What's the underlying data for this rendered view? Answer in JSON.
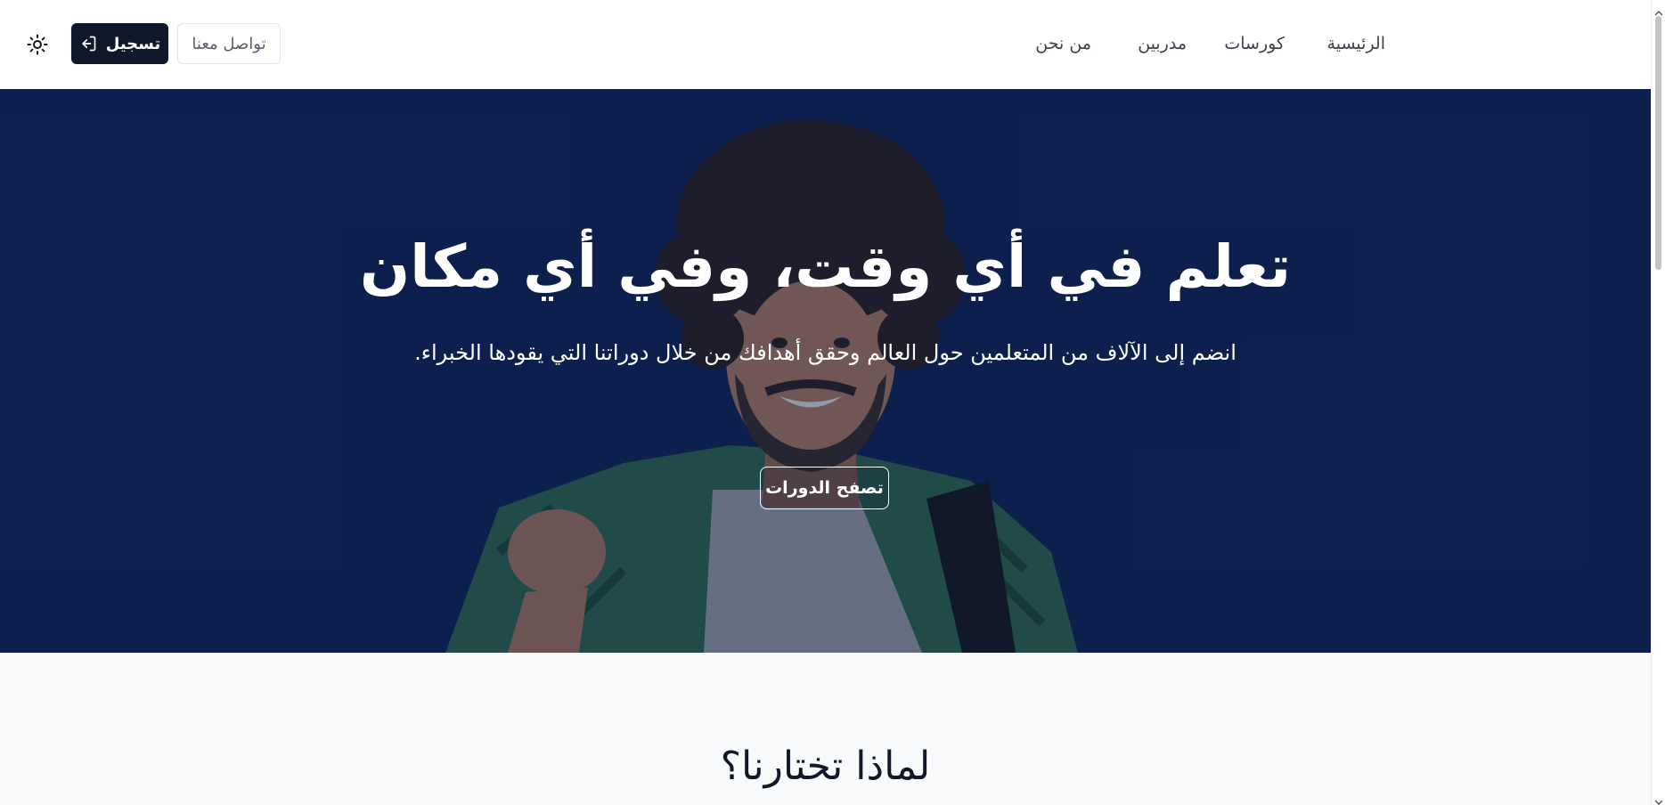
{
  "header": {
    "nav": [
      {
        "label": "الرئيسية"
      },
      {
        "label": "كورسات"
      },
      {
        "label": "مدربين"
      },
      {
        "label": "من نحن"
      }
    ],
    "signup_label": "تسجيل",
    "contact_label": "تواصل معنا",
    "theme_icon": "sun-icon"
  },
  "hero": {
    "title": "تعلم في أي وقت، وفي أي مكان",
    "subtitle": "انضم إلى الآلاف من المتعلمين حول العالم وحقق أهدافك من خلال دوراتنا التي يقودها الخبراء.",
    "browse_label": "تصفح الدورات"
  },
  "why": {
    "title": "لماذا تختارنا؟"
  },
  "colors": {
    "primary": "#0f172a",
    "hero_bg": "#0f2150",
    "section_bg": "#f8f9fb"
  }
}
